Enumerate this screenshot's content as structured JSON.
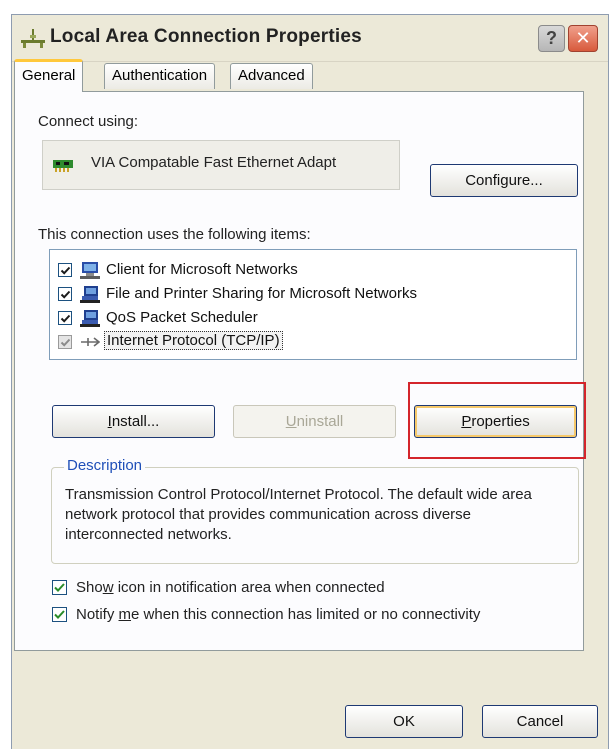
{
  "window": {
    "title": "Local Area Connection Properties",
    "help_label": "?",
    "close_label": "✕"
  },
  "tabs": [
    {
      "label": "General",
      "active": true
    },
    {
      "label": "Authentication",
      "active": false
    },
    {
      "label": "Advanced",
      "active": false
    }
  ],
  "connect_using": {
    "label": "Connect using:",
    "adapter": "VIA Compatable Fast Ethernet Adapt",
    "configure_label": "Configure..."
  },
  "items": {
    "label": "This connection uses the following items:",
    "list": [
      {
        "label": "Client for Microsoft Networks",
        "checked": true,
        "icon": "network-client-icon"
      },
      {
        "label": "File and Printer Sharing for Microsoft Networks",
        "checked": true,
        "icon": "computer-share-icon"
      },
      {
        "label": "QoS Packet Scheduler",
        "checked": true,
        "icon": "computer-share-icon"
      },
      {
        "label": "Internet Protocol (TCP/IP)",
        "checked": true,
        "disabled": true,
        "selected": true,
        "icon": "protocol-icon"
      }
    ]
  },
  "buttons": {
    "install": "Install...",
    "uninstall": "Uninstall",
    "properties": "Properties"
  },
  "description": {
    "legend": "Description",
    "text": "Transmission Control Protocol/Internet Protocol. The default wide area network protocol that provides communication across diverse interconnected networks."
  },
  "options": {
    "show_icon": "Show icon in notification area when connected",
    "notify": "Notify me when this connection has limited or no connectivity"
  },
  "footer": {
    "ok": "OK",
    "cancel": "Cancel"
  },
  "colors": {
    "dialog_bg": "#ece9d8",
    "tab_highlight": "#ffc83c",
    "annotation_red": "#d4252b",
    "legend_blue": "#1f4fb8"
  }
}
